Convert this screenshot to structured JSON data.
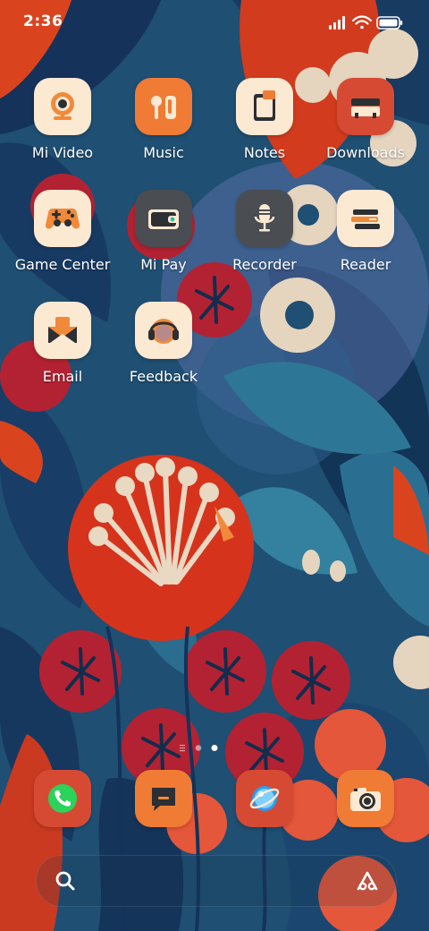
{
  "status_bar": {
    "time": "2:36"
  },
  "apps": [
    {
      "label": "Mi Video",
      "icon": "mi-video-icon"
    },
    {
      "label": "Music",
      "icon": "music-icon"
    },
    {
      "label": "Notes",
      "icon": "notes-icon"
    },
    {
      "label": "Downloads",
      "icon": "downloads-icon"
    },
    {
      "label": "Game Center",
      "icon": "game-controller-icon"
    },
    {
      "label": "Mi Pay",
      "icon": "wallet-icon"
    },
    {
      "label": "Recorder",
      "icon": "microphone-icon"
    },
    {
      "label": "Reader",
      "icon": "books-icon"
    },
    {
      "label": "Email",
      "icon": "envelope-icon"
    },
    {
      "label": "Feedback",
      "icon": "headphones-icon"
    }
  ],
  "page_indicator": {
    "pages": 2,
    "active": 2
  },
  "dock": [
    {
      "icon": "phone-icon"
    },
    {
      "icon": "messages-icon"
    },
    {
      "icon": "browser-icon"
    },
    {
      "icon": "camera-icon"
    }
  ],
  "colors": {
    "wallpaper_bg": "#1d4a6e",
    "accent_red": "#d63a22",
    "accent_orange": "#f08a3a",
    "tile_cream": "#fbe9d2"
  }
}
